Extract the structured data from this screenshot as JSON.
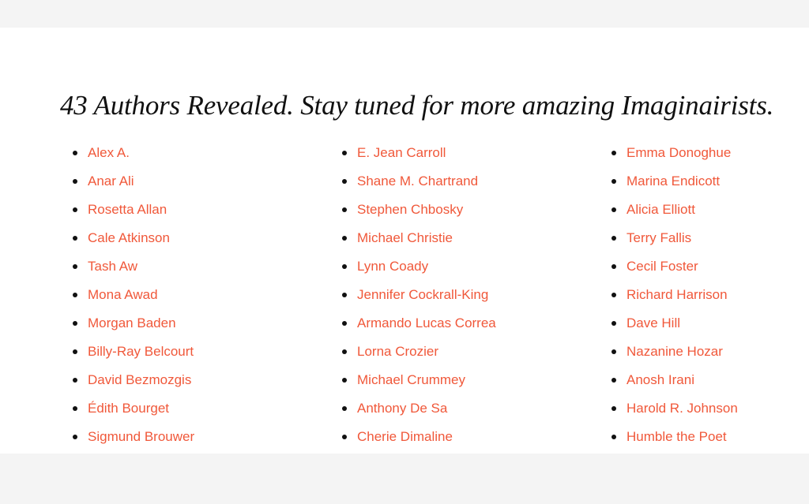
{
  "page": {
    "background_color": "#f4f4f4",
    "panel_color": "#ffffff",
    "link_color": "#f0583a"
  },
  "heading": "43 Authors Revealed. Stay tuned for more amazing Imaginairists.",
  "columns": [
    {
      "authors": [
        "Alex A.",
        "Anar Ali",
        "Rosetta Allan",
        "Cale Atkinson",
        "Tash Aw",
        "Mona Awad",
        "Morgan Baden",
        "Billy-Ray Belcourt",
        "David Bezmozgis",
        "Édith Bourget",
        "Sigmund Brouwer"
      ]
    },
    {
      "authors": [
        "E. Jean Carroll",
        "Shane M. Chartrand",
        "Stephen Chbosky",
        "Michael Christie",
        "Lynn Coady",
        "Jennifer Cockrall-King",
        "Armando Lucas Correa",
        "Lorna Crozier",
        "Michael Crummey",
        "Anthony De Sa",
        "Cherie Dimaline"
      ]
    },
    {
      "authors": [
        "Emma Donoghue",
        "Marina Endicott",
        "Alicia Elliott",
        "Terry Fallis",
        "Cecil Foster",
        "Richard Harrison",
        "Dave Hill",
        "Nazanine Hozar",
        "Anosh Irani",
        "Harold R. Johnson",
        "Humble the Poet"
      ]
    }
  ]
}
